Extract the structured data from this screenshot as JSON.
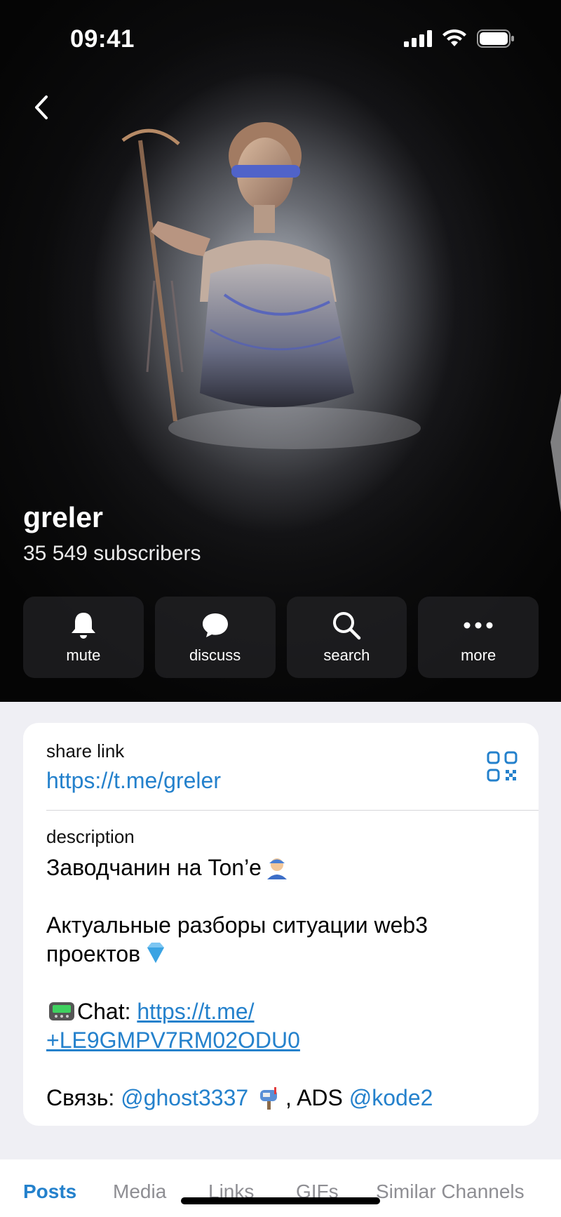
{
  "status_bar": {
    "time": "09:41"
  },
  "channel": {
    "name": "greler",
    "subscribers": "35 549 subscribers"
  },
  "actions": [
    {
      "label": "mute",
      "icon": "bell-icon"
    },
    {
      "label": "discuss",
      "icon": "chat-bubble-icon"
    },
    {
      "label": "search",
      "icon": "search-icon"
    },
    {
      "label": "more",
      "icon": "more-dots-icon"
    }
  ],
  "share": {
    "label": "share link",
    "url": "https://t.me/greler",
    "icon": "qr-code-icon"
  },
  "description": {
    "label": "description",
    "line1": "Заводчанин на Ton’е",
    "line2": "Актуальные разборы ситуации web3",
    "line3": "проектов",
    "chat_prefix": "Chat: ",
    "chat_link_part1": "https://t.me/",
    "chat_link_part2": "+LE9GMPV7RM02ODU0",
    "contact_prefix": "Связь: ",
    "contact_handle": "@ghost3337",
    "ads_text": ", ADS ",
    "ads_handle": "@kode2",
    "emojis": [
      "worker-emoji",
      "diamond-emoji",
      "pager-emoji",
      "mailbox-emoji"
    ]
  },
  "tabs": [
    "Posts",
    "Media",
    "Links",
    "GIFs",
    "Similar Channels"
  ],
  "colors": {
    "accent": "#2481cc",
    "background": "#efeff4",
    "header": "#0b0b0c"
  }
}
